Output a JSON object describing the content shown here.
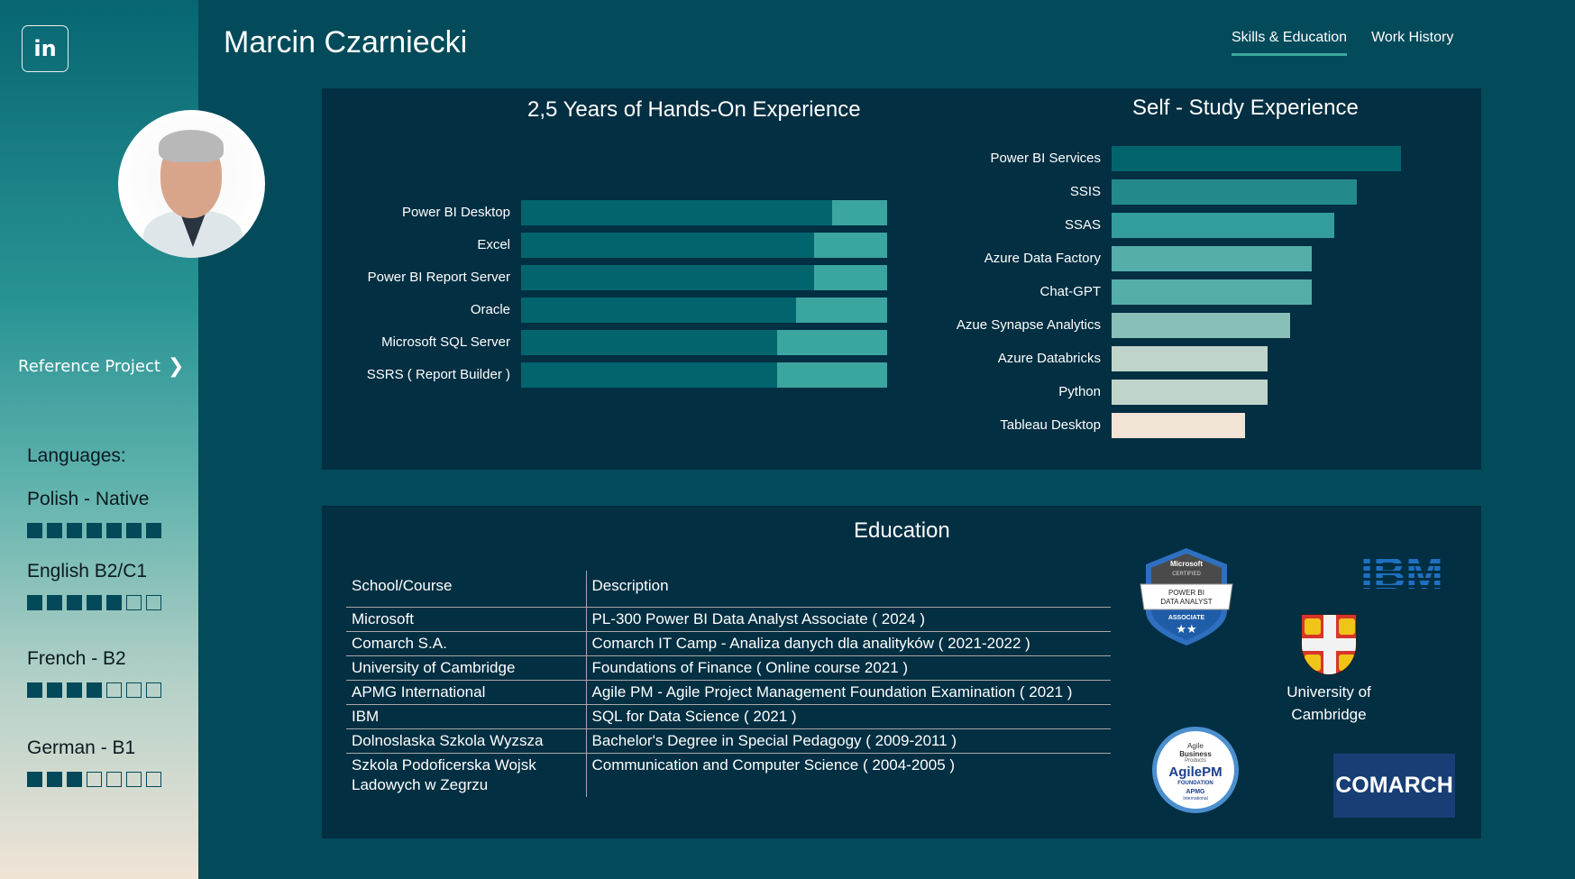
{
  "header": {
    "name": "Marcin Czarniecki",
    "tabs": [
      {
        "label": "Skills & Education",
        "active": true
      },
      {
        "label": "Work History",
        "active": false
      }
    ]
  },
  "sidebar": {
    "linkedin_label": "in",
    "reference_project": "Reference Project",
    "languages_title": "Languages:",
    "languages": [
      {
        "name": "Polish - Native",
        "level": 7,
        "max": 7
      },
      {
        "name": "English B2/C1",
        "level": 5,
        "max": 7
      },
      {
        "name": "French -  B2",
        "level": 4,
        "max": 7
      },
      {
        "name": "German - B1",
        "level": 3,
        "max": 7
      }
    ]
  },
  "chart_data": [
    {
      "type": "bar",
      "orientation": "horizontal",
      "stacked": true,
      "title": "2,5 Years of Hands-On Experience",
      "categories": [
        "Power BI Desktop",
        "Excel",
        "Power BI Report Server",
        "Oracle",
        "Microsoft SQL Server",
        "SSRS ( Report Builder )"
      ],
      "series": [
        {
          "name": "achieved",
          "color": "#02656e",
          "values": [
            85,
            80,
            80,
            75,
            70,
            70
          ]
        },
        {
          "name": "remaining",
          "color": "#3ba5a0",
          "values": [
            15,
            20,
            20,
            25,
            30,
            30
          ]
        }
      ],
      "xlim": [
        0,
        100
      ]
    },
    {
      "type": "bar",
      "orientation": "horizontal",
      "title": "Self - Study Experience",
      "categories": [
        "Power BI Services",
        "SSIS",
        "SSAS",
        "Azure Data Factory",
        "Chat-GPT",
        "Azue Synapse Analytics",
        "Azure Databricks",
        "Python",
        "Tableau Desktop"
      ],
      "values": [
        130,
        110,
        100,
        90,
        90,
        80,
        70,
        70,
        60
      ],
      "colors": [
        "#02656e",
        "#23898b",
        "#339c9c",
        "#55aeaa",
        "#55aeaa",
        "#89bfb9",
        "#c0d4ca",
        "#c0d4ca",
        "#f1e3d6"
      ],
      "xlim": [
        0,
        130
      ]
    }
  ],
  "education": {
    "title": "Education",
    "columns": [
      "School/Course",
      "Description"
    ],
    "rows": [
      [
        "Microsoft",
        "PL-300 Power BI Data Analyst Associate ( 2024 )"
      ],
      [
        "Comarch S.A.",
        "Comarch IT Camp - Analiza danych dla analityków ( 2021-2022 )"
      ],
      [
        "University of Cambridge",
        "Foundations of Finance ( Online course 2021 )"
      ],
      [
        "APMG International",
        "Agile PM - Agile Project Management Foundation Examination ( 2021 )"
      ],
      [
        "IBM",
        "SQL for Data Science ( 2021 )"
      ],
      [
        "Dolnoslaska Szkola Wyzsza",
        "Bachelor's Degree in Special Pedagogy ( 2009-2011 )"
      ],
      [
        "Szkola Podoficerska Wojsk Ladowych w Zegrzu",
        "Communication and Computer Science ( 2004-2005 )"
      ]
    ],
    "logos": {
      "ms_badge": {
        "line1": "Microsoft",
        "line2": "CERTIFIED",
        "line3": "POWER BI",
        "line4": "DATA ANALYST",
        "line5": "ASSOCIATE",
        "stars": "★★"
      },
      "ibm": "IBM",
      "cambridge": {
        "line1": "University of",
        "line2": "Cambridge"
      },
      "agile": {
        "line1": "Agile",
        "line2": "Business",
        "line3": "Products",
        "line4": "AgilePM",
        "line5": "FOUNDATION",
        "line6": "APMG",
        "line7": "International"
      },
      "comarch": "COMARCH"
    }
  }
}
